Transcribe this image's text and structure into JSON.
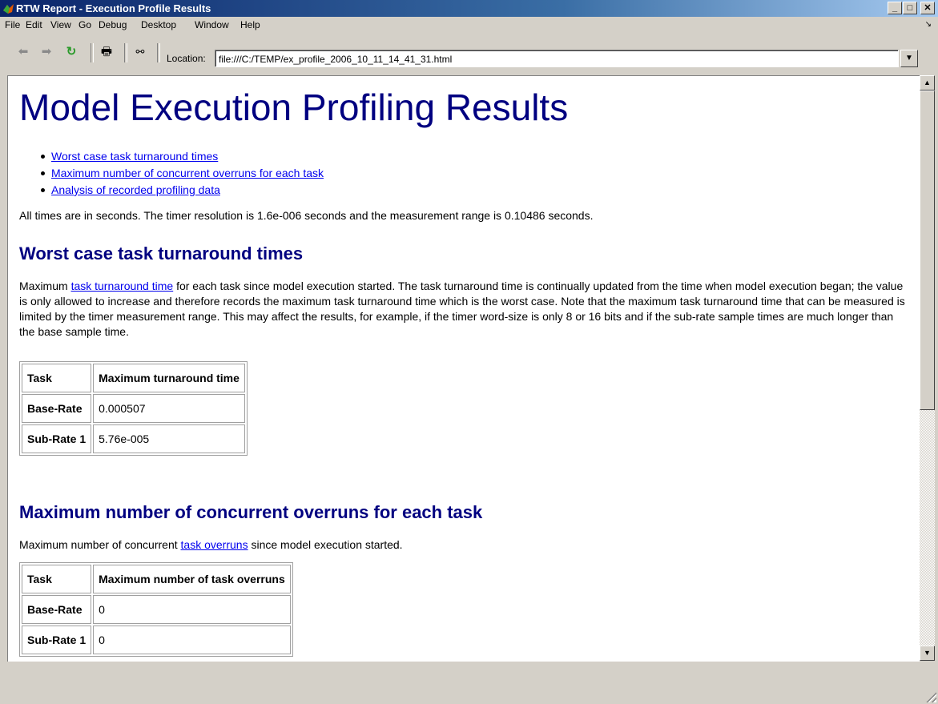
{
  "window": {
    "title": "RTW Report - Execution Profile Results",
    "buttons": [
      "_",
      "□",
      "✕"
    ]
  },
  "menu": [
    "File",
    "Edit",
    "View",
    "Go",
    "Debug",
    "Desktop",
    "Window",
    "Help"
  ],
  "toolbar": {
    "location_label": "Location:",
    "location_value": "file:///C:/TEMP/ex_profile_2006_10_11_14_41_31.html"
  },
  "page": {
    "title": "Model Execution Profiling Results",
    "toc": [
      "Worst case task turnaround times",
      "Maximum number of concurrent overruns for each task",
      "Analysis of recorded profiling data"
    ],
    "intro": "All times are in seconds. The timer resolution is 1.6e-006 seconds and the measurement range is 0.10486 seconds.",
    "section1": {
      "heading": "Worst case task turnaround times",
      "text_before": "Maximum ",
      "link": "task turnaround time",
      "text_after": " for each task since model execution started. The task turnaround time is continually updated from the time when model execution began; the value is only allowed to increase and therefore records the maximum task turnaround time which is the worst case. Note that the maximum task turnaround time that can be measured is limited by the timer measurement range. This may affect the results, for example, if the timer word-size is only 8 or 16 bits and if the sub-rate sample times are much longer than the base sample time.",
      "table": {
        "headers": [
          "Task",
          "Maximum turnaround time"
        ],
        "rows": [
          [
            "Base-Rate",
            "0.000507"
          ],
          [
            "Sub-Rate 1",
            "5.76e-005"
          ]
        ]
      }
    },
    "section2": {
      "heading": "Maximum number of concurrent overruns for each task",
      "text_before": "Maximum number of concurrent ",
      "link": "task overruns",
      "text_after": " since model execution started.",
      "table": {
        "headers": [
          "Task",
          "Maximum number of task overruns"
        ],
        "rows": [
          [
            "Base-Rate",
            "0"
          ],
          [
            "Sub-Rate 1",
            "0"
          ]
        ]
      }
    }
  }
}
